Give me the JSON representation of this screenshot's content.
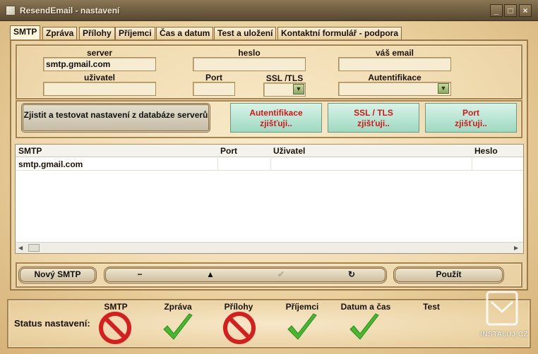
{
  "window": {
    "title": "ResendEmail - nastavení",
    "controls": [
      "_",
      "□",
      "×"
    ]
  },
  "tabs": [
    {
      "label": "SMTP",
      "active": true
    },
    {
      "label": "Zpráva"
    },
    {
      "label": "Přílohy"
    },
    {
      "label": "Příjemci"
    },
    {
      "label": "Čas a datum"
    },
    {
      "label": "Test a uložení"
    },
    {
      "label": "Kontaktní formulář - podpora"
    }
  ],
  "form": {
    "server": {
      "label": "server",
      "value": "smtp.gmail.com"
    },
    "heslo": {
      "label": "heslo",
      "value": ""
    },
    "email": {
      "label": "váš email",
      "value": ""
    },
    "uzivatel": {
      "label": "uživatel",
      "value": ""
    },
    "port": {
      "label": "Port",
      "value": ""
    },
    "ssl": {
      "label": "SSL /TLS",
      "value": ""
    },
    "auth": {
      "label": "Autentifikace",
      "value": ""
    }
  },
  "detect": {
    "main_button": "Zjistit a testovat nastavení z databáze serverů",
    "auth_label": "Autentifikace",
    "ssl_label": "SSL / TLS",
    "port_label": "Port",
    "status_text": "zjišťuji.."
  },
  "table": {
    "columns": [
      "SMTP",
      "Port",
      "Uživatel",
      "Heslo"
    ],
    "rows": [
      [
        "smtp.gmail.com",
        "",
        "",
        ""
      ]
    ]
  },
  "actions": {
    "new_smtp": "Nový SMTP",
    "nav_minus": "−",
    "nav_up": "▲",
    "nav_check": "✔",
    "nav_refresh": "↻",
    "use": "Použít"
  },
  "status": {
    "label": "Status nastavení:",
    "items": [
      {
        "name": "SMTP",
        "state": "error"
      },
      {
        "name": "Zpráva",
        "state": "ok"
      },
      {
        "name": "Přílohy",
        "state": "error"
      },
      {
        "name": "Příjemci",
        "state": "ok"
      },
      {
        "name": "Datum a čas",
        "state": "ok"
      },
      {
        "name": "Test",
        "state": "none"
      }
    ]
  },
  "watermark": {
    "text": "INSTALUJ.CZ"
  },
  "colors": {
    "ok": "#45b82e",
    "error": "#d51f1f",
    "detect_text": "#d21919"
  }
}
